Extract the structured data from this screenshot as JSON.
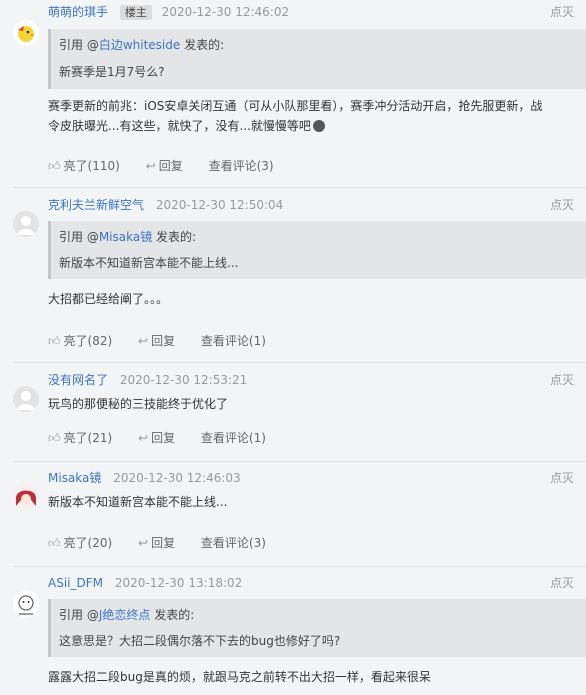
{
  "comments": [
    {
      "author": "萌萌的琪手",
      "badge": "楼主",
      "time": "2020-12-30 12:46:02",
      "report": "点灭",
      "quote": {
        "prefix": "引用 @",
        "user": "白边whiteside",
        "suffix": " 发表的:",
        "text": "新赛季是1月7号么?"
      },
      "body_line1": "赛季更新的前兆：iOS安卓关闭互通（可从小队那里看），赛季冲分活动开启，抢先服更新，战",
      "body_line2": "令皮肤曝光...有这些，就快了，没有...就慢慢等吧",
      "like_label": "亮了(110)",
      "reply_label": "回复",
      "view_label": "查看评论(3)"
    },
    {
      "author": "克利夫兰新鲜空气",
      "time": "2020-12-30 12:50:04",
      "report": "点灭",
      "quote": {
        "prefix": "引用 @",
        "user": "Misaka镜",
        "suffix": " 发表的:",
        "text": "新版本不知道新宫本能不能上线..."
      },
      "body_line1": "大招都已经给阐了。。。",
      "like_label": "亮了(82)",
      "reply_label": "回复",
      "view_label": "查看评论(1)"
    },
    {
      "author": "没有网名了",
      "time": "2020-12-30 12:53:21",
      "report": "点灭",
      "body_line1": "玩鸟的那便秘的三技能终于优化了",
      "like_label": "亮了(21)",
      "reply_label": "回复",
      "view_label": "查看评论(1)"
    },
    {
      "author": "Misaka镜",
      "time": "2020-12-30 12:46:03",
      "report": "点灭",
      "body_line1": "新版本不知道新宫本能不能上线...",
      "like_label": "亮了(20)",
      "reply_label": "回复",
      "view_label": "查看评论(3)"
    },
    {
      "author": "ASii_DFM",
      "time": "2020-12-30 13:18:02",
      "report": "点灭",
      "quote": {
        "prefix": "引用 @",
        "user": "J绝恋终点",
        "suffix": " 发表的:",
        "text": "这意思是？大招二段偶尔落不下去的bug也修好了吗?"
      },
      "body_line1": "露露大招二段bug是真的烦，就跟马克之前转不出大招一样，看起来很呆"
    }
  ],
  "icons": {
    "like": "thumbs-up-icon",
    "reply": "reply-arrow-icon",
    "emoji": "emoji-face-icon"
  }
}
